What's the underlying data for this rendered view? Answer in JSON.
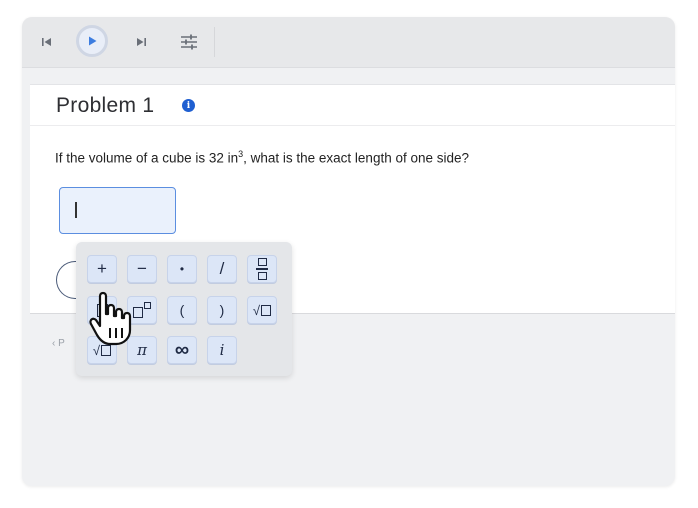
{
  "toolbar": {
    "prev_icon": "skip-back-icon",
    "play_icon": "play-icon",
    "next_icon": "skip-forward-icon",
    "settings_icon": "sliders-icon",
    "accent": "#5b8ee0"
  },
  "problem": {
    "title": "Problem 1",
    "info_icon_glyph": "i",
    "question_pre": "If the volume of a cube is 32 in",
    "question_exp": "3",
    "question_post": ", what is the exact length of one side?",
    "answer_value": ""
  },
  "below": {
    "link_text": "‹ P"
  },
  "keypad": {
    "row1": [
      "+",
      "−",
      "•",
      "/",
      "fraction"
    ],
    "row2": [
      "box",
      "power",
      "(",
      ")",
      "sqrt"
    ],
    "row3": [
      "nthroot",
      "π",
      "∞",
      "i"
    ],
    "labels": {
      "plus": "+",
      "minus": "−",
      "dot": "•",
      "slash": "/",
      "lparen": "(",
      "rparen": ")",
      "pi": "π",
      "infinity": "∞",
      "imag": "i",
      "sqrt": "√",
      "nthroot": "√"
    }
  }
}
